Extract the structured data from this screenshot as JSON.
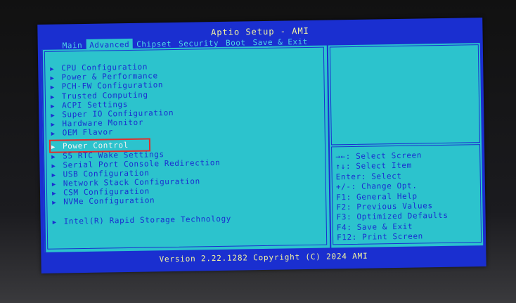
{
  "window": {
    "title": "Aptio Setup - AMI"
  },
  "tabs": [
    {
      "label": "Main",
      "active": false
    },
    {
      "label": "Advanced",
      "active": true
    },
    {
      "label": "Chipset",
      "active": false
    },
    {
      "label": "Security",
      "active": false
    },
    {
      "label": "Boot",
      "active": false
    },
    {
      "label": "Save & Exit",
      "active": false
    }
  ],
  "menu": {
    "items": [
      {
        "label": "CPU Configuration"
      },
      {
        "label": "Power & Performance"
      },
      {
        "label": "PCH-FW Configuration"
      },
      {
        "label": "Trusted Computing"
      },
      {
        "label": "ACPI Settings"
      },
      {
        "label": "Super IO Configuration"
      },
      {
        "label": "Hardware Monitor"
      },
      {
        "label": "OEM Flavor"
      },
      {
        "label": "Power Control",
        "selected": true
      },
      {
        "label": "S5 RTC Wake Settings"
      },
      {
        "label": "Serial Port Console Redirection"
      },
      {
        "label": "USB Configuration"
      },
      {
        "label": "Network Stack Configuration"
      },
      {
        "label": "CSM Configuration"
      },
      {
        "label": "NVMe Configuration"
      }
    ],
    "extra_item": {
      "label": "Intel(R) Rapid Storage Technology"
    },
    "arrow_glyph": "▶"
  },
  "help": {
    "lines": [
      "→←: Select Screen",
      "↑↓: Select Item",
      "Enter: Select",
      "+/-: Change Opt.",
      "F1: General Help",
      "F2: Previous Values",
      "F3: Optimized Defaults",
      "F4: Save & Exit",
      "F12: Print Screen"
    ]
  },
  "footer": {
    "version": "Version 2.22.1282 Copyright (C) 2024 AMI"
  },
  "colors": {
    "screen_blue": "#1a2fd0",
    "panel_cyan": "#2cc3cd",
    "title_yellow": "#f4f4a0",
    "selection_outline": "#e0302c"
  }
}
